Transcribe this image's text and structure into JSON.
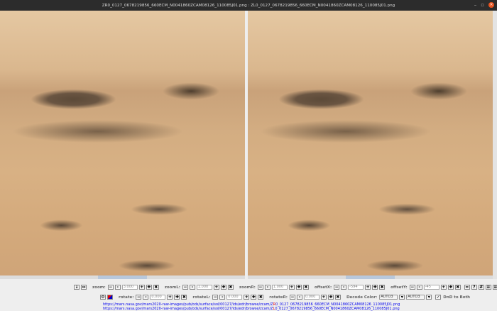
{
  "window": {
    "title": "ZR0_0127_0678219856_660ECM_N0041860ZCAM08126_110085J01.png : ZL0_0127_0678219856_660ECM_N0041860ZCAM08126_110085J01.png"
  },
  "controls": {
    "zoom": {
      "label": "zoom:",
      "value": "3.000"
    },
    "zoomL": {
      "label": "zoomL:",
      "value": "1.000"
    },
    "zoomR": {
      "label": "zoomR:",
      "value": "1.000"
    },
    "offsetX": {
      "label": "offsetX:",
      "value": "-594"
    },
    "offsetY": {
      "label": "offsetY:",
      "value": "-45"
    },
    "rotate": {
      "label": "rotate:",
      "value": "0.000"
    },
    "rotateL": {
      "label": "rotateL:",
      "value": "0.000"
    },
    "rotateR": {
      "label": "rotateR:",
      "value": "0.000"
    },
    "decode": {
      "label": "Decode Color:",
      "left": "AUTO3",
      "right": "AUTO3"
    },
    "dnd": {
      "label": "DnD to Both",
      "checked": true
    }
  },
  "links": {
    "right": {
      "prefix": "https://mars.nasa.gov/mars2020-raw-images/pub/ods/surface/sol/00127/ids/edr/browse/zcam/Z",
      "eye": "R",
      "suffix": "0_0127_0678219856_660ECM_N0041860ZCAM08126_110085J01.png"
    },
    "left": {
      "prefix": "https://mars.nasa.gov/mars2020-raw-images/pub/ods/surface/sol/00127/ids/edr/browse/zcam/Z",
      "eye": "L",
      "suffix": "0_0127_0678219856_660ECM_N0041860ZCAM08126_110085J01.png"
    }
  }
}
